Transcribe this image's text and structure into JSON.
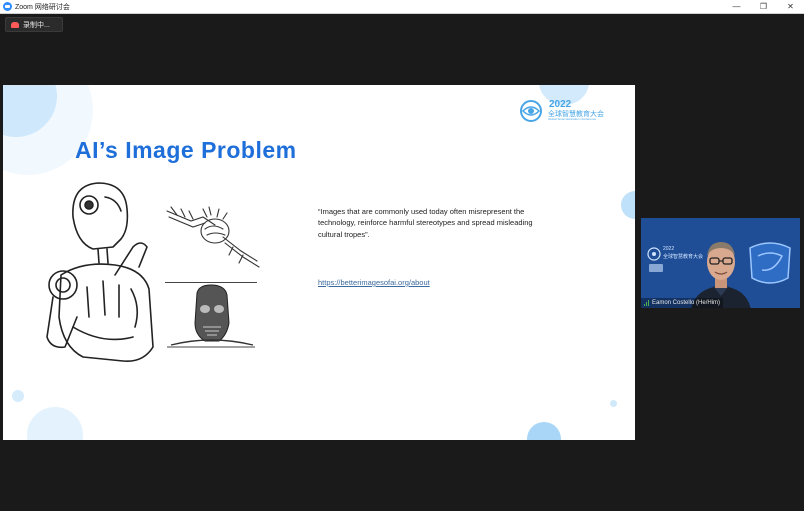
{
  "window": {
    "title": "Zoom 网络研讨会",
    "minimize_glyph": "—",
    "maximize_glyph": "❐",
    "close_glyph": "✕"
  },
  "recording": {
    "label": "录制中..."
  },
  "slide": {
    "title": "AI’s Image Problem",
    "quote": "“Images that are commonly used today often misrepresent the technology, reinforce harmful stereotypes and spread misleading cultural tropes”.",
    "link": "https://betterimagesofai.org/about",
    "logo": {
      "year": "2022",
      "name_cn": "全球智慧教育大会",
      "name_en": "Global Smart Education Conference"
    }
  },
  "participant": {
    "name": "Eamon Costello (He/Him)",
    "bg_logo_year": "2022",
    "bg_logo_cn": "全球智慧教育大会"
  },
  "colors": {
    "title_blue": "#1e6fd9",
    "accent_light_blue": "#49a6e6",
    "tile_blue": "#1f4e96"
  }
}
